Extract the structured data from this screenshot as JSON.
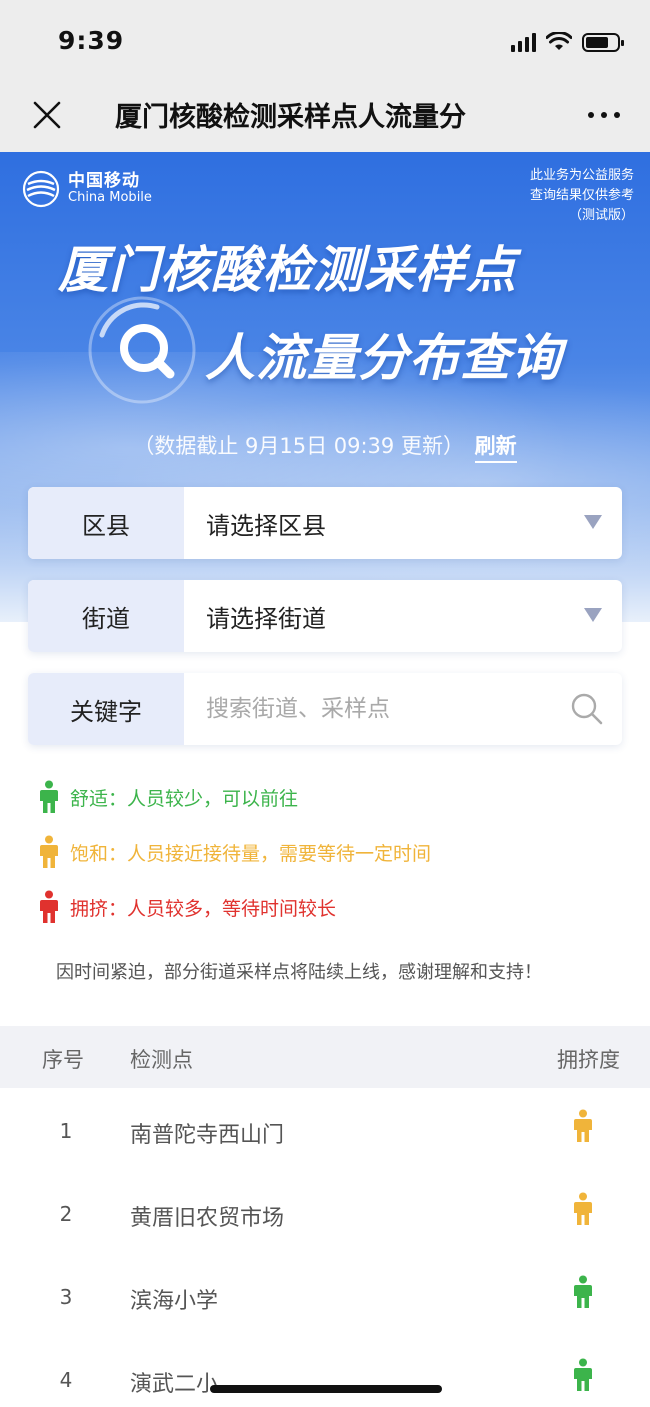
{
  "status_bar": {
    "time": "9:39"
  },
  "nav": {
    "title": "厦门核酸检测采样点人流量分"
  },
  "banner": {
    "logo_cn": "中国移动",
    "logo_en": "China Mobile",
    "notice_lines": [
      "此业务为公益服务",
      "查询结果仅供参考",
      "（测试版）"
    ],
    "hero_line1": "厦门核酸检测采样点",
    "hero_line2": "人流量分布查询",
    "update_text": "（数据截止 9月15日 09:39 更新）",
    "refresh_label": "刷新"
  },
  "form": {
    "district": {
      "label": "区县",
      "value": "请选择区县"
    },
    "street": {
      "label": "街道",
      "value": "请选择街道"
    },
    "keyword": {
      "label": "关键字",
      "placeholder": "搜索街道、采样点"
    }
  },
  "legend": {
    "comfortable": {
      "text": "舒适：人员较少，可以前往",
      "color": "#3cb44b"
    },
    "saturated": {
      "text": "饱和：人员接近接待量，需要等待一定时间",
      "color": "#f0b43a"
    },
    "crowded": {
      "text": "拥挤：人员较多，等待时间较长",
      "color": "#e0322e"
    }
  },
  "tip": "因时间紧迫，部分街道采样点将陆续上线，感谢理解和支持！",
  "table": {
    "headers": {
      "index": "序号",
      "site": "检测点",
      "crowd": "拥挤度"
    },
    "rows": [
      {
        "index": "1",
        "name": "南普陀寺西山门",
        "crowd_level": "saturated"
      },
      {
        "index": "2",
        "name": "黄厝旧农贸市场",
        "crowd_level": "saturated"
      },
      {
        "index": "3",
        "name": "滨海小学",
        "crowd_level": "comfortable"
      },
      {
        "index": "4",
        "name": "演武二小",
        "crowd_level": "comfortable"
      }
    ]
  },
  "colors": {
    "brand_blue": "#2f6fe0",
    "label_bg": "#e7ecfa"
  }
}
